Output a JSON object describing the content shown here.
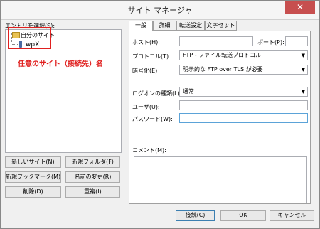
{
  "window": {
    "title": "サイト マネージャ",
    "close_glyph": "✕"
  },
  "entries": {
    "label": "エントリを選択(S):",
    "root": "自分のサイト",
    "site": "wpX"
  },
  "annotation": {
    "text": "任意のサイト（接続先）名",
    "color": "#e0201f"
  },
  "left_buttons": {
    "new_site": "新しいサイト(N)",
    "new_folder": "新規フォルダ(F)",
    "new_bookmark": "新規ブックマーク(M)",
    "rename": "名前の変更(R)",
    "delete": "削除(D)",
    "duplicate": "重複(I)"
  },
  "tabs": [
    "一般",
    "詳細",
    "転送設定",
    "文字セット"
  ],
  "general": {
    "host_label": "ホスト(H):",
    "host_value": "",
    "port_label": "ポート(P):",
    "port_value": "",
    "protocol_label": "プロトコル(T)",
    "protocol_value": "FTP - ファイル転送プロトコル",
    "encryption_label": "暗号化(E)",
    "encryption_value": "明示的な FTP over TLS が必要",
    "logon_type_label": "ログオンの種類(L):",
    "logon_type_value": "通常",
    "user_label": "ユーザ(U):",
    "user_value": "",
    "password_label": "パスワード(W):",
    "password_value": "",
    "comment_label": "コメント(M):"
  },
  "dialog_buttons": {
    "connect": "接続(C)",
    "ok": "OK",
    "cancel": "キャンセル"
  }
}
